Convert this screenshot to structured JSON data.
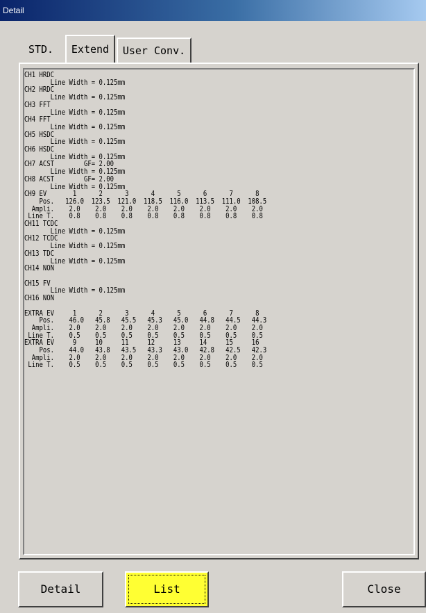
{
  "window": {
    "title": "Detail"
  },
  "tabs": {
    "std": "STD.",
    "extend": "Extend",
    "user_conv": "User Conv."
  },
  "detail_text": "CH1 HRDC\n       Line Width = 0.125mm\nCH2 HRDC\n       Line Width = 0.125mm\nCH3 FFT\n       Line Width = 0.125mm\nCH4 FFT\n       Line Width = 0.125mm\nCH5 HSDC\n       Line Width = 0.125mm\nCH6 HSDC\n       Line Width = 0.125mm\nCH7 ACST        GF= 2.00\n       Line Width = 0.125mm\nCH8 ACST        GF= 2.00\n       Line Width = 0.125mm\nCH9 EV       1      2      3      4      5      6      7      8\n    Pos.   126.0  123.5  121.0  118.5  116.0  113.5  111.0  108.5\n  Ampli.    2.0    2.0    2.0    2.0    2.0    2.0    2.0    2.0\n Line T.    0.8    0.8    0.8    0.8    0.8    0.8    0.8    0.8\nCH11 TCDC\n       Line Width = 0.125mm\nCH12 TCDC\n       Line Width = 0.125mm\nCH13 TDC\n       Line Width = 0.125mm\nCH14 NON\n\nCH15 FV\n       Line Width = 0.125mm\nCH16 NON\n\nEXTRA EV     1      2      3      4      5      6      7      8\n    Pos.    46.0   45.8   45.5   45.3   45.0   44.8   44.5   44.3\n  Ampli.    2.0    2.0    2.0    2.0    2.0    2.0    2.0    2.0\n Line T.    0.5    0.5    0.5    0.5    0.5    0.5    0.5    0.5\nEXTRA EV     9     10     11     12     13     14     15     16\n    Pos.    44.0   43.8   43.5   43.3   43.0   42.8   42.5   42.3\n  Ampli.    2.0    2.0    2.0    2.0    2.0    2.0    2.0    2.0\n Line T.    0.5    0.5    0.5    0.5    0.5    0.5    0.5    0.5",
  "buttons": {
    "detail": "Detail",
    "list": "List",
    "close": "Close"
  },
  "colors": {
    "list_button": "#ffff33",
    "background": "#d6d3ce",
    "titlebar": "#0a246a"
  }
}
